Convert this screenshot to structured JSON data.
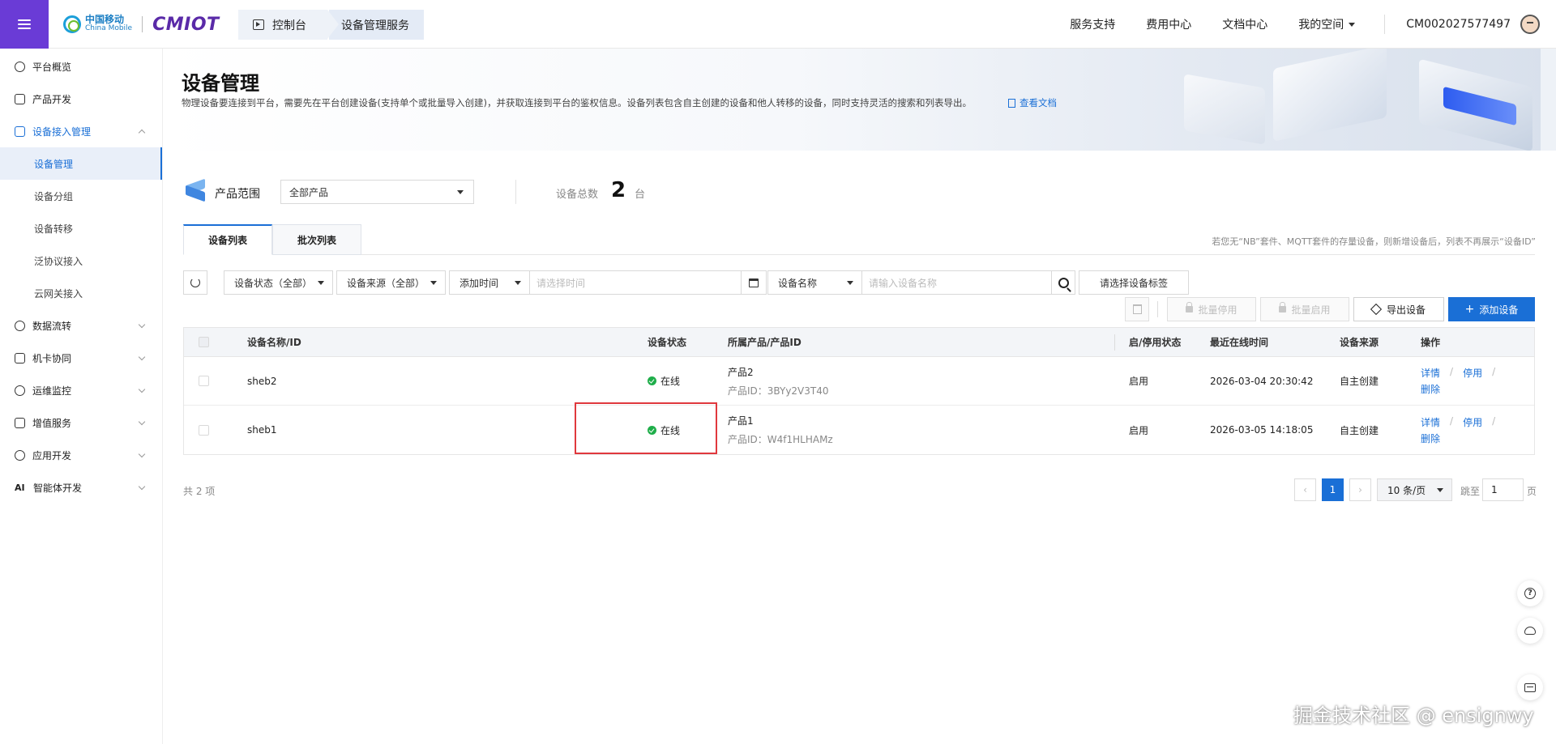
{
  "topbar": {
    "brand_cn": "中国移动",
    "brand_en": "China Mobile",
    "brand_product": "CMIOT",
    "breadcrumb": [
      "控制台",
      "设备管理服务"
    ],
    "nav": [
      "服务支持",
      "费用中心",
      "文档中心"
    ],
    "space_label": "我的空间",
    "account": "CM002027577497"
  },
  "sidebar": {
    "items": [
      {
        "label": "平台概览",
        "icon": "gear-icon"
      },
      {
        "label": "产品开发",
        "icon": "cube-icon"
      },
      {
        "label": "设备接入管理",
        "icon": "device-access-icon"
      },
      {
        "label": "数据流转",
        "icon": "data-flow-icon"
      },
      {
        "label": "机卡协同",
        "icon": "sim-link-icon"
      },
      {
        "label": "运维监控",
        "icon": "monitor-icon"
      },
      {
        "label": "增值服务",
        "icon": "value-added-icon"
      },
      {
        "label": "应用开发",
        "icon": "app-dev-icon"
      },
      {
        "label": "智能体开发",
        "icon": "ai-icon"
      }
    ],
    "sub_items": [
      "设备管理",
      "设备分组",
      "设备转移",
      "泛协议接入",
      "云网关接入"
    ]
  },
  "header": {
    "title": "设备管理",
    "description": "物理设备要连接到平台，需要先在平台创建设备(支持单个或批量导入创建)，并获取连接到平台的鉴权信息。设备列表包含自主创建的设备和他人转移的设备，同时支持灵活的搜索和列表导出。",
    "doc_link": "查看文档"
  },
  "filter": {
    "product_scope_label": "产品范围",
    "product_scope_value": "全部产品",
    "total_label": "设备总数",
    "total_value": "2",
    "total_unit": "台"
  },
  "tabs": [
    "设备列表",
    "批次列表"
  ],
  "tab_note": "若您无“NB”套件、MQTT套件的存量设备，则新增设备后，列表不再展示“设备ID”",
  "search": {
    "status_select": "设备状态（全部）",
    "source_select": "设备来源（全部）",
    "time_select": "添加时间",
    "time_placeholder": "请选择时间",
    "field_select": "设备名称",
    "name_placeholder": "请输入设备名称",
    "tag_select": "请选择设备标签"
  },
  "actions": {
    "batch_disable": "批量停用",
    "batch_enable": "批量启用",
    "export": "导出设备",
    "add": "添加设备"
  },
  "table": {
    "columns": [
      "设备名称/ID",
      "设备状态",
      "所属产品/产品ID",
      "启/停用状态",
      "最近在线时间",
      "设备来源",
      "操作"
    ],
    "rows": [
      {
        "name": "sheb2",
        "status": "在线",
        "product": "产品2",
        "product_id_label": "产品ID：",
        "product_id": "3BYy2V3T40",
        "enabled": "启用",
        "last_online": "2026-03-04 20:30:42",
        "source": "自主创建",
        "op_detail": "详情",
        "op_disable": "停用",
        "op_delete": "删除"
      },
      {
        "name": "sheb1",
        "status": "在线",
        "product": "产品1",
        "product_id_label": "产品ID：",
        "product_id": "W4f1HLHAMz",
        "enabled": "启用",
        "last_online": "2026-03-05 14:18:05",
        "source": "自主创建",
        "op_detail": "详情",
        "op_disable": "停用",
        "op_delete": "删除"
      }
    ],
    "slash": "/"
  },
  "pagination": {
    "total_text": "共 2 项",
    "current_page": "1",
    "page_size": "10 条/页",
    "jump_label": "跳至",
    "jump_value": "1",
    "jump_unit": "页",
    "prev": "‹",
    "next": "›"
  },
  "watermark": "掘金技术社区 @ ensignwy",
  "colors": {
    "accent": "#1a6fd6",
    "menu": "#6a3bd6",
    "online": "#1fae4a",
    "highlight": "#e0383d"
  }
}
